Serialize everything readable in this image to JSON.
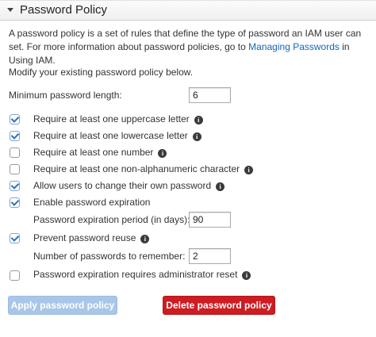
{
  "panel": {
    "title": "Password Policy"
  },
  "intro": {
    "text_before": "A password policy is a set of rules that define the type of password an IAM user can set. For more information about password policies, go to ",
    "link_text": "Managing Passwords",
    "text_after": " in Using IAM."
  },
  "subtext": "Modify your existing password policy below.",
  "min_length": {
    "label": "Minimum password length:",
    "value": "6"
  },
  "options": [
    {
      "label": "Require at least one uppercase letter",
      "checked": true,
      "info": true
    },
    {
      "label": "Require at least one lowercase letter",
      "checked": true,
      "info": true
    },
    {
      "label": "Require at least one number",
      "checked": false,
      "info": true
    },
    {
      "label": "Require at least one non-alphanumeric character",
      "checked": false,
      "info": true
    },
    {
      "label": "Allow users to change their own password",
      "checked": true,
      "info": true
    },
    {
      "label": "Enable password expiration",
      "checked": true,
      "info": false
    },
    {
      "label": "Prevent password reuse",
      "checked": true,
      "info": true
    },
    {
      "label": "Password expiration requires administrator reset",
      "checked": false,
      "info": true
    }
  ],
  "expiration_period": {
    "label": "Password expiration period (in days):",
    "value": "90"
  },
  "reuse_count": {
    "label": "Number of passwords to remember:",
    "value": "2"
  },
  "info_glyph": "i",
  "buttons": {
    "apply_label": "Apply password policy",
    "delete_label": "Delete password policy"
  },
  "colors": {
    "link": "#1166bb",
    "apply_button_disabled": "#a9c6e8",
    "delete_button": "#cc1d23",
    "checkbox_check": "#2f6fc0"
  }
}
